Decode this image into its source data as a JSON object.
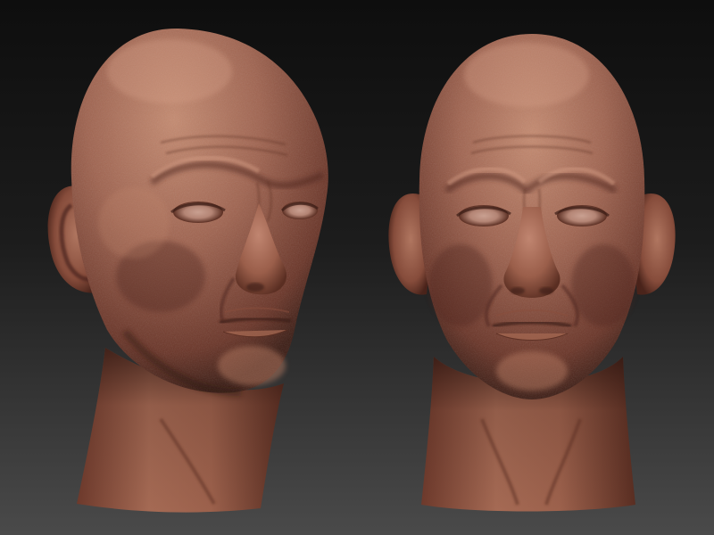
{
  "scene": {
    "background_top": "#0e0e0e",
    "background_bottom": "#4a4a4a",
    "skin_light": "#b57a62",
    "skin_mid": "#8f5443",
    "skin_dark": "#5a2e22",
    "skin_shadow": "#3a1c15",
    "heads": [
      {
        "view": "three-quarter"
      },
      {
        "view": "front"
      }
    ]
  }
}
